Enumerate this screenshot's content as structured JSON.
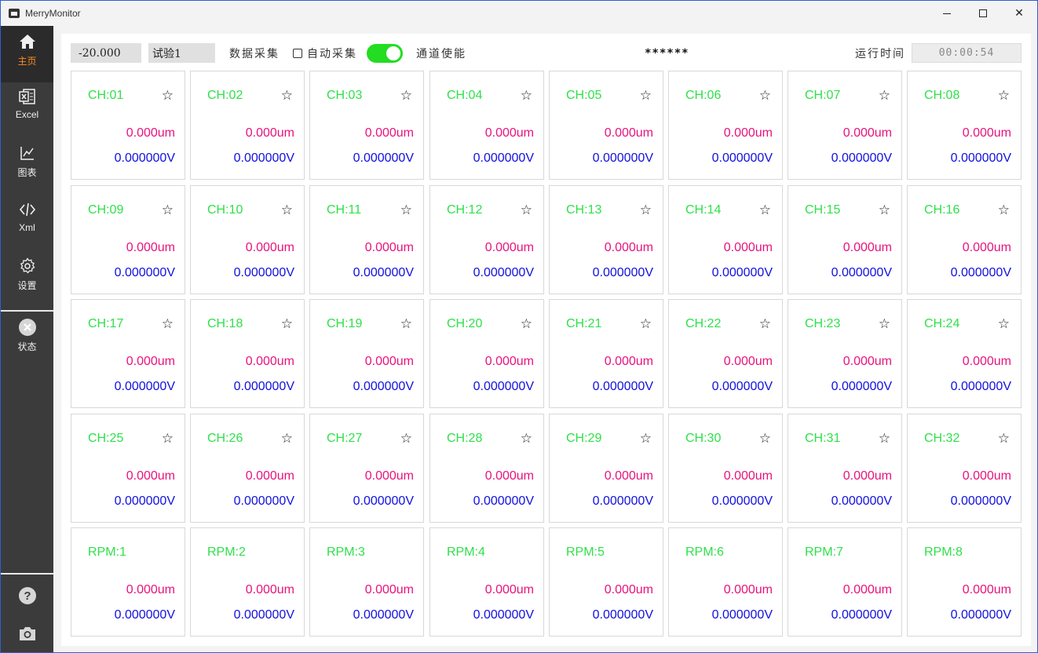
{
  "window": {
    "title": "MerryMonitor"
  },
  "sidebar": {
    "items": [
      {
        "label": "主页",
        "icon": "home-icon"
      },
      {
        "label": "Excel",
        "icon": "excel-icon"
      },
      {
        "label": "图表",
        "icon": "chart-icon"
      },
      {
        "label": "Xml",
        "icon": "code-icon"
      },
      {
        "label": "设置",
        "icon": "gear-icon"
      },
      {
        "label": "状态",
        "icon": "status-close-icon"
      }
    ],
    "bottom": [
      {
        "icon": "help-icon"
      },
      {
        "icon": "camera-icon"
      }
    ]
  },
  "toolbar": {
    "value_field": "-20.000",
    "experiment_field": "试验1",
    "data_collect_label": "数据采集",
    "auto_collect_label": "自动采集",
    "auto_collect_checked": false,
    "channel_enable_label": "通道使能",
    "channel_enable_on": true,
    "masked_text": "******",
    "runtime_label": "运行时间",
    "runtime_value": "00:00:54"
  },
  "colors": {
    "name": "#2fe04a",
    "um": "#e8127d",
    "volt": "#1010e0",
    "toggle": "#22dd22",
    "active_label": "#ff8c1a"
  },
  "channels": [
    {
      "name": "CH:01",
      "um": "0.000um",
      "v": "0.000000V",
      "star": true
    },
    {
      "name": "CH:02",
      "um": "0.000um",
      "v": "0.000000V",
      "star": true
    },
    {
      "name": "CH:03",
      "um": "0.000um",
      "v": "0.000000V",
      "star": true
    },
    {
      "name": "CH:04",
      "um": "0.000um",
      "v": "0.000000V",
      "star": true
    },
    {
      "name": "CH:05",
      "um": "0.000um",
      "v": "0.000000V",
      "star": true
    },
    {
      "name": "CH:06",
      "um": "0.000um",
      "v": "0.000000V",
      "star": true
    },
    {
      "name": "CH:07",
      "um": "0.000um",
      "v": "0.000000V",
      "star": true
    },
    {
      "name": "CH:08",
      "um": "0.000um",
      "v": "0.000000V",
      "star": true
    },
    {
      "name": "CH:09",
      "um": "0.000um",
      "v": "0.000000V",
      "star": true
    },
    {
      "name": "CH:10",
      "um": "0.000um",
      "v": "0.000000V",
      "star": true
    },
    {
      "name": "CH:11",
      "um": "0.000um",
      "v": "0.000000V",
      "star": true
    },
    {
      "name": "CH:12",
      "um": "0.000um",
      "v": "0.000000V",
      "star": true
    },
    {
      "name": "CH:13",
      "um": "0.000um",
      "v": "0.000000V",
      "star": true
    },
    {
      "name": "CH:14",
      "um": "0.000um",
      "v": "0.000000V",
      "star": true
    },
    {
      "name": "CH:15",
      "um": "0.000um",
      "v": "0.000000V",
      "star": true
    },
    {
      "name": "CH:16",
      "um": "0.000um",
      "v": "0.000000V",
      "star": true
    },
    {
      "name": "CH:17",
      "um": "0.000um",
      "v": "0.000000V",
      "star": true
    },
    {
      "name": "CH:18",
      "um": "0.000um",
      "v": "0.000000V",
      "star": true
    },
    {
      "name": "CH:19",
      "um": "0.000um",
      "v": "0.000000V",
      "star": true
    },
    {
      "name": "CH:20",
      "um": "0.000um",
      "v": "0.000000V",
      "star": true
    },
    {
      "name": "CH:21",
      "um": "0.000um",
      "v": "0.000000V",
      "star": true
    },
    {
      "name": "CH:22",
      "um": "0.000um",
      "v": "0.000000V",
      "star": true
    },
    {
      "name": "CH:23",
      "um": "0.000um",
      "v": "0.000000V",
      "star": true
    },
    {
      "name": "CH:24",
      "um": "0.000um",
      "v": "0.000000V",
      "star": true
    },
    {
      "name": "CH:25",
      "um": "0.000um",
      "v": "0.000000V",
      "star": true
    },
    {
      "name": "CH:26",
      "um": "0.000um",
      "v": "0.000000V",
      "star": true
    },
    {
      "name": "CH:27",
      "um": "0.000um",
      "v": "0.000000V",
      "star": true
    },
    {
      "name": "CH:28",
      "um": "0.000um",
      "v": "0.000000V",
      "star": true
    },
    {
      "name": "CH:29",
      "um": "0.000um",
      "v": "0.000000V",
      "star": true
    },
    {
      "name": "CH:30",
      "um": "0.000um",
      "v": "0.000000V",
      "star": true
    },
    {
      "name": "CH:31",
      "um": "0.000um",
      "v": "0.000000V",
      "star": true
    },
    {
      "name": "CH:32",
      "um": "0.000um",
      "v": "0.000000V",
      "star": true
    },
    {
      "name": "RPM:1",
      "um": "0.000um",
      "v": "0.000000V",
      "star": false
    },
    {
      "name": "RPM:2",
      "um": "0.000um",
      "v": "0.000000V",
      "star": false
    },
    {
      "name": "RPM:3",
      "um": "0.000um",
      "v": "0.000000V",
      "star": false
    },
    {
      "name": "RPM:4",
      "um": "0.000um",
      "v": "0.000000V",
      "star": false
    },
    {
      "name": "RPM:5",
      "um": "0.000um",
      "v": "0.000000V",
      "star": false
    },
    {
      "name": "RPM:6",
      "um": "0.000um",
      "v": "0.000000V",
      "star": false
    },
    {
      "name": "RPM:7",
      "um": "0.000um",
      "v": "0.000000V",
      "star": false
    },
    {
      "name": "RPM:8",
      "um": "0.000um",
      "v": "0.000000V",
      "star": false
    }
  ]
}
